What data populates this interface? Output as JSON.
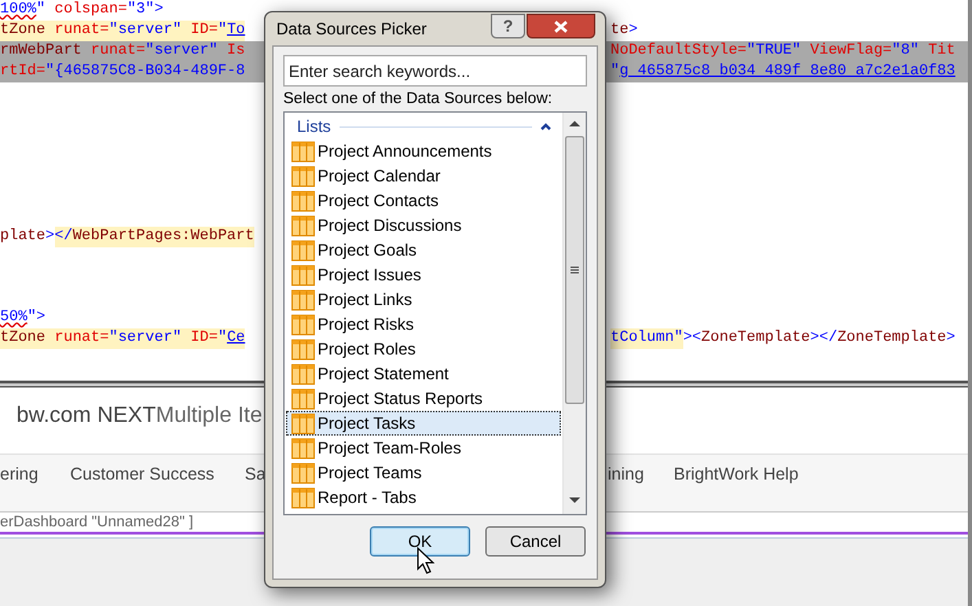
{
  "editor": {
    "blocks": [
      {
        "lines": [
          {
            "selected": false,
            "left": [
              {
                "kind": "squiggle",
                "text": "100%",
                "marked": false
              },
              {
                "kind": "value",
                "text": "\"",
                "marked": false
              },
              {
                "kind": "attr",
                "text": " colspan=",
                "marked": false
              },
              {
                "kind": "value",
                "text": "\"3\">",
                "marked": false
              }
            ]
          },
          {
            "selected": false,
            "left": [
              {
                "kind": "tag",
                "text": "tZone",
                "marked": true
              },
              {
                "kind": "attr",
                "text": " runat=",
                "marked": true
              },
              {
                "kind": "value",
                "text": "\"server\"",
                "marked": true
              },
              {
                "kind": "attr",
                "text": " ID=",
                "marked": true
              },
              {
                "kind": "value",
                "text": "\"",
                "marked": true
              },
              {
                "kind": "link",
                "text": "To",
                "marked": true
              }
            ],
            "right": [
              {
                "kind": "tag",
                "text": "te",
                "marked": false
              },
              {
                "kind": "value",
                "text": ">",
                "marked": false
              }
            ]
          },
          {
            "selected": true,
            "left": [
              {
                "kind": "tag",
                "text": "rmWebPart",
                "marked": false
              },
              {
                "kind": "attr",
                "text": " runat=",
                "marked": false
              },
              {
                "kind": "value",
                "text": "\"server\"",
                "marked": false
              },
              {
                "kind": "attr",
                "text": " Is",
                "marked": false
              }
            ],
            "right": [
              {
                "kind": "attr",
                "text": "NoDefaultStyle=",
                "marked": false
              },
              {
                "kind": "value",
                "text": "\"TRUE\"",
                "marked": false
              },
              {
                "kind": "attr",
                "text": " ViewFlag=",
                "marked": false
              },
              {
                "kind": "value",
                "text": "\"8\"",
                "marked": false
              },
              {
                "kind": "attr",
                "text": " Tit",
                "marked": false
              }
            ]
          },
          {
            "selected": true,
            "left": [
              {
                "kind": "attr",
                "text": "rtId=",
                "marked": false
              },
              {
                "kind": "value",
                "text": "\"{465875C8-B034-489F-8",
                "marked": false
              }
            ],
            "right": [
              {
                "kind": "value",
                "text": "\"",
                "marked": false
              },
              {
                "kind": "link",
                "text": "g 465875c8 b034 489f 8e80 a7c2e1a0f83",
                "marked": false
              }
            ]
          }
        ]
      },
      {
        "lines": [
          {
            "selected": false,
            "left": [
              {
                "kind": "tag",
                "text": "plate",
                "marked": false
              },
              {
                "kind": "value",
                "text": ">",
                "marked": false
              },
              {
                "kind": "value",
                "text": "</",
                "marked": true
              },
              {
                "kind": "tag",
                "text": "WebPartPages:WebPart",
                "marked": true
              }
            ]
          }
        ]
      },
      {
        "lines": [
          {
            "selected": false,
            "left": [
              {
                "kind": "squiggle",
                "text": "50%",
                "marked": false
              },
              {
                "kind": "value",
                "text": "\">",
                "marked": false
              }
            ]
          },
          {
            "selected": false,
            "left": [
              {
                "kind": "tag",
                "text": "tZone",
                "marked": true
              },
              {
                "kind": "attr",
                "text": " runat=",
                "marked": true
              },
              {
                "kind": "value",
                "text": "\"server\"",
                "marked": true
              },
              {
                "kind": "attr",
                "text": " ID=",
                "marked": true
              },
              {
                "kind": "value",
                "text": "\"",
                "marked": true
              },
              {
                "kind": "link",
                "text": "Ce",
                "marked": true
              }
            ],
            "right": [
              {
                "kind": "value",
                "text": "tColumn\"",
                "marked": true
              },
              {
                "kind": "value",
                "text": ">",
                "marked": false
              },
              {
                "kind": "value",
                "text": "<",
                "marked": false
              },
              {
                "kind": "tag",
                "text": "ZoneTemplate",
                "marked": false
              },
              {
                "kind": "value",
                "text": "></",
                "marked": false
              },
              {
                "kind": "tag",
                "text": "ZoneTemplate",
                "marked": false
              },
              {
                "kind": "value",
                "text": ">",
                "marked": false
              }
            ]
          }
        ]
      }
    ]
  },
  "preview": {
    "site_title": "bw.com NEXT",
    "page_title": "Multiple Ite",
    "nav": [
      {
        "label": "ering"
      },
      {
        "label": "Customer Success"
      },
      {
        "label": "Sa"
      },
      {
        "label": "ining"
      },
      {
        "label": "BrightWork Help"
      }
    ],
    "status_line": "erDashboard \"Unnamed28\" ]"
  },
  "dialog": {
    "title": "Data Sources Picker",
    "help": "?",
    "search": {
      "placeholder": "Enter search keywords..."
    },
    "instruction": "Select one of the Data Sources below:",
    "group": {
      "label": "Lists",
      "expanded": true
    },
    "items": [
      {
        "label": "Project Announcements",
        "selected": false
      },
      {
        "label": "Project Calendar",
        "selected": false
      },
      {
        "label": "Project Contacts",
        "selected": false
      },
      {
        "label": "Project Discussions",
        "selected": false
      },
      {
        "label": "Project Goals",
        "selected": false
      },
      {
        "label": "Project Issues",
        "selected": false
      },
      {
        "label": "Project Links",
        "selected": false
      },
      {
        "label": "Project Risks",
        "selected": false
      },
      {
        "label": "Project Roles",
        "selected": false
      },
      {
        "label": "Project Statement",
        "selected": false
      },
      {
        "label": "Project Status Reports",
        "selected": false
      },
      {
        "label": "Project Tasks",
        "selected": true
      },
      {
        "label": "Project Team-Roles",
        "selected": false
      },
      {
        "label": "Project Teams",
        "selected": false
      },
      {
        "label": "Report - Tabs",
        "selected": false
      }
    ],
    "buttons": [
      {
        "label": "OK",
        "kind": "default"
      },
      {
        "label": "Cancel",
        "kind": "normal"
      }
    ]
  }
}
